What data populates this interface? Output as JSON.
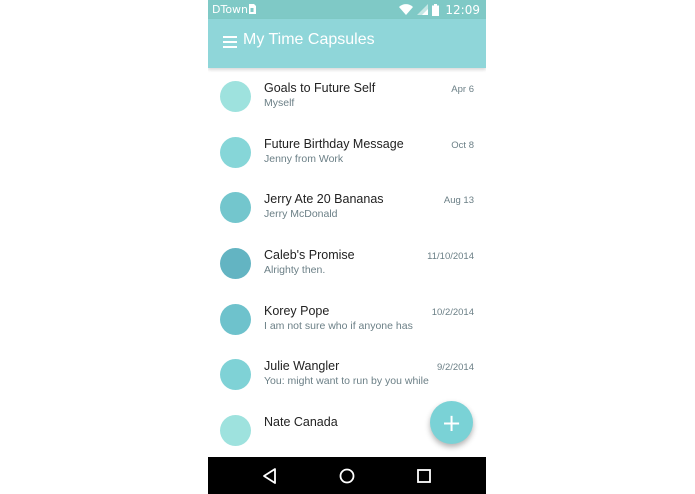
{
  "statusbar": {
    "carrier": "DTown",
    "time": "12:09"
  },
  "toolbar": {
    "title": "My Time Capsules"
  },
  "capsules": [
    {
      "name": "Goals to Future Self",
      "preview": "Myself",
      "date": "Apr 6",
      "color": "#9ee2de"
    },
    {
      "name": "Future Birthday Message",
      "preview": "Jenny from Work",
      "date": "Oct 8",
      "color": "#86d6d8"
    },
    {
      "name": "Jerry Ate 20 Bananas",
      "preview": "Jerry McDonald",
      "date": "Aug 13",
      "color": "#73c6cd"
    },
    {
      "name": "Caleb's Promise",
      "preview": "Alrighty then.",
      "date": "11/10/2014",
      "color": "#63b4c2"
    },
    {
      "name": "Korey Pope",
      "preview": "I am not sure who if anyone has",
      "date": "10/2/2014",
      "color": "#6ec2cc"
    },
    {
      "name": "Julie Wangler",
      "preview": "You: might want to run by you while",
      "date": "9/2/2014",
      "color": "#7fd2d6"
    },
    {
      "name": "Nate Canada",
      "preview": "",
      "date": "",
      "color": "#9ee2de"
    }
  ],
  "fab": {
    "icon": "plus-icon",
    "label": "+"
  },
  "navbar": {
    "icons": [
      "back-icon",
      "home-icon",
      "recents-icon"
    ]
  },
  "colors": {
    "statusbar": "#7fc9c6",
    "toolbar": "#8fd6d9",
    "fab": "#7ad2d6",
    "text_primary": "#222222",
    "text_secondary": "#6b7f86"
  }
}
